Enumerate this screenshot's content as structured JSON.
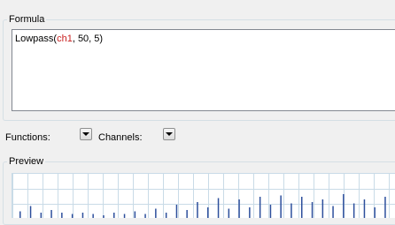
{
  "formula": {
    "title": "Formula",
    "tokens": [
      {
        "text": "Lowpass(",
        "kind": "fn"
      },
      {
        "text": "ch1",
        "kind": "channel"
      },
      {
        "text": ", 50, 5)",
        "kind": "fn"
      }
    ]
  },
  "options": {
    "functions_label": "Functions:",
    "channels_label": "Channels:"
  },
  "preview": {
    "title": "Preview",
    "chart_data": {
      "type": "bar",
      "grid": true,
      "grid_color": "#c9dbe7",
      "bar_color": "#2d4f9c",
      "values": [
        0.25,
        0.45,
        0.2,
        0.3,
        0.2,
        0.15,
        0.2,
        0.15,
        0.1,
        0.2,
        0.15,
        0.25,
        0.15,
        0.35,
        0.2,
        0.5,
        0.3,
        0.6,
        0.4,
        0.75,
        0.35,
        0.7,
        0.4,
        0.8,
        0.5,
        0.85,
        0.55,
        0.8,
        0.6,
        0.7,
        0.45,
        0.9,
        0.55,
        0.7,
        0.4,
        0.8
      ]
    }
  }
}
